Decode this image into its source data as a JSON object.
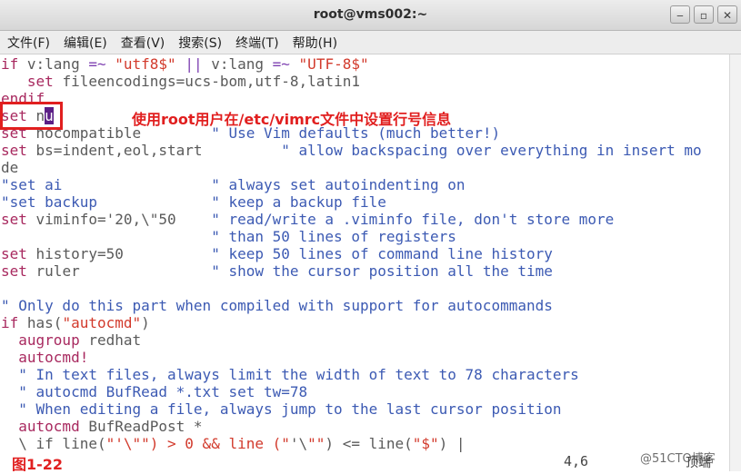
{
  "window": {
    "title": "root@vms002:~",
    "buttons": {
      "minimize": "‒",
      "maximize": "▫",
      "close": "✕"
    }
  },
  "menu": [
    "文件(F)",
    "编辑(E)",
    "查看(V)",
    "搜索(S)",
    "终端(T)",
    "帮助(H)"
  ],
  "editor": {
    "lines": [
      "if v:lang =~ \"utf8$\" || v:lang =~ \"UTF-8$\"",
      "   set fileencodings=ucs-bom,utf-8,latin1",
      "endif",
      "set nu",
      "set nocompatible        \" Use Vim defaults (much better!)",
      "set bs=indent,eol,start         \" allow backspacing over everything in insert mo",
      "de",
      "\"set ai                 \" always set autoindenting on",
      "\"set backup             \" keep a backup file",
      "set viminfo='20,\\\"50    \" read/write a .viminfo file, don't store more",
      "                        \" than 50 lines of registers",
      "set history=50          \" keep 50 lines of command line history",
      "set ruler               \" show the cursor position all the time",
      "",
      "\" Only do this part when compiled with support for autocommands",
      "if has(\"autocmd\")",
      "  augroup redhat",
      "  autocmd!",
      "  \" In text files, always limit the width of text to 78 characters",
      "  \" autocmd BufRead *.txt set tw=78",
      "  \" When editing a file, always jump to the last cursor position",
      "  autocmd BufReadPost *",
      "  \\ if line(\"'\\\"\") > 0 && line (\"'\\\"\") <= line(\"$\") |"
    ],
    "cursor_position": "4,6",
    "scroll_percent": "顶端"
  },
  "annotation": "使用root用户在/etc/vimrc文件中设置行号信息",
  "figure_label": "图1-22",
  "watermark": "@51CTO博客",
  "colors": {
    "highlight": "#e11f1f",
    "keyword": "#a8295f",
    "comment": "#3c5ab3",
    "string": "#d23a2c",
    "cursor": "#5b1f86"
  }
}
